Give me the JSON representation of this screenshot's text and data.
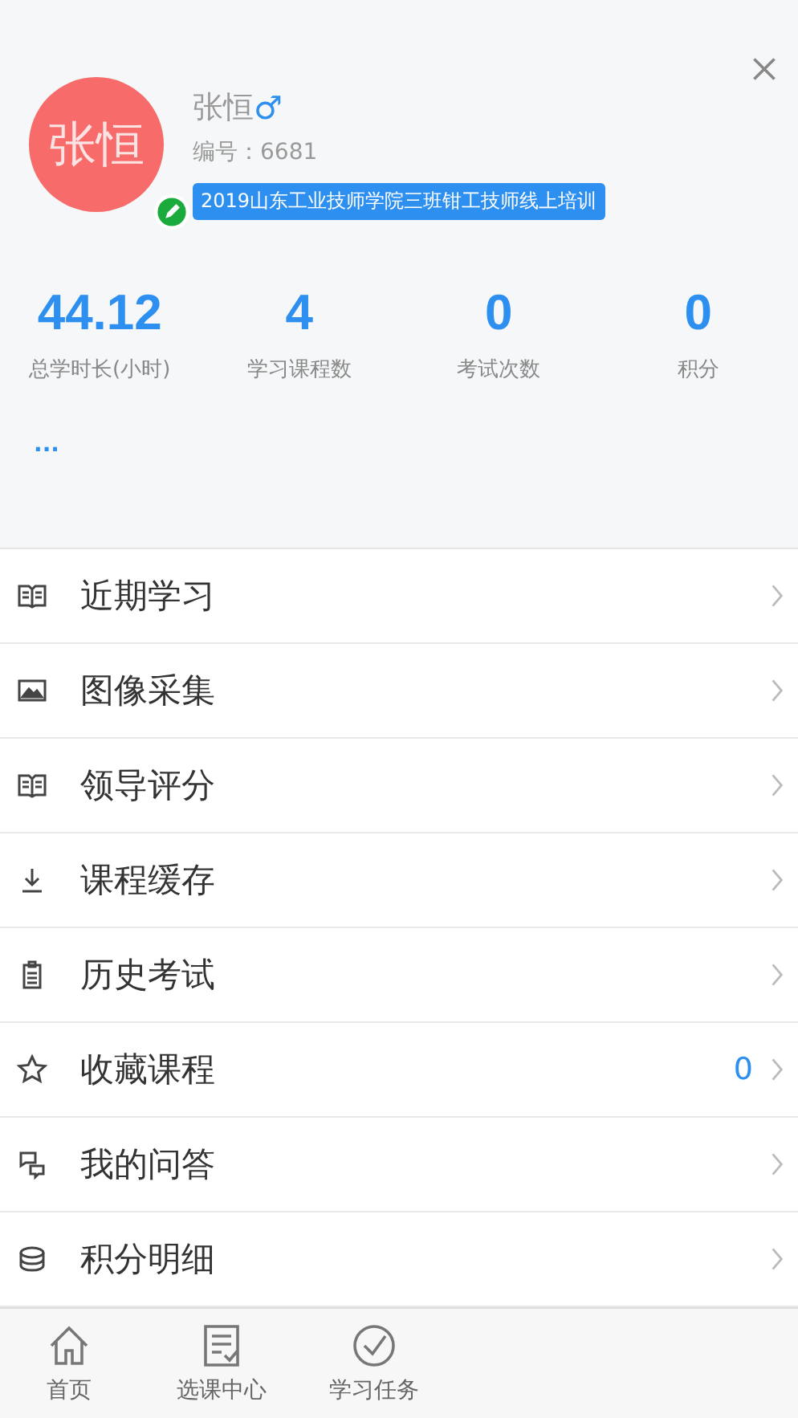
{
  "profile": {
    "avatar_text": "张恒",
    "name": "张恒",
    "gender": "♂",
    "id_label": "编号：",
    "id": "6681",
    "class_tag": "2019山东工业技师学院三班钳工技师线上培训"
  },
  "stats": [
    {
      "value": "44.12",
      "label": "总学时长(小时)"
    },
    {
      "value": "4",
      "label": "学习课程数"
    },
    {
      "value": "0",
      "label": "考试次数"
    },
    {
      "value": "0",
      "label": "积分"
    }
  ],
  "more": "...",
  "menu": [
    {
      "kind": "book",
      "label": "近期学习"
    },
    {
      "kind": "image",
      "label": "图像采集"
    },
    {
      "kind": "book",
      "label": "领导评分"
    },
    {
      "kind": "download",
      "label": "课程缓存"
    },
    {
      "kind": "clipboard",
      "label": "历史考试"
    },
    {
      "kind": "star",
      "label": "收藏课程",
      "count": "0"
    },
    {
      "kind": "chat",
      "label": "我的问答"
    },
    {
      "kind": "coins",
      "label": "积分明细"
    }
  ],
  "tabbar": [
    {
      "kind": "home",
      "label": "首页"
    },
    {
      "kind": "list",
      "label": "选课中心"
    },
    {
      "kind": "check",
      "label": "学习任务"
    }
  ]
}
